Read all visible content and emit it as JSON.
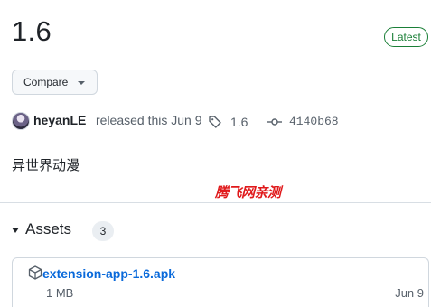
{
  "release": {
    "title": "1.6",
    "badge": "Latest",
    "compare_label": "Compare",
    "author": "heyanLE",
    "released_text": "released this Jun 9",
    "tag": "1.6",
    "commit": "4140b68",
    "body": "异世界动漫"
  },
  "watermark": {
    "text": "腾飞网亲测"
  },
  "assets": {
    "title": "Assets",
    "count": "3",
    "items": [
      {
        "name": "extension-app-1.6.apk",
        "size": "1 MB",
        "date": "Jun 9",
        "icon": "package-icon"
      }
    ]
  },
  "colors": {
    "latest_green": "#1a7f37",
    "link_blue": "#0969da",
    "muted_text": "#57606a",
    "watermark_red": "#e0191b"
  }
}
